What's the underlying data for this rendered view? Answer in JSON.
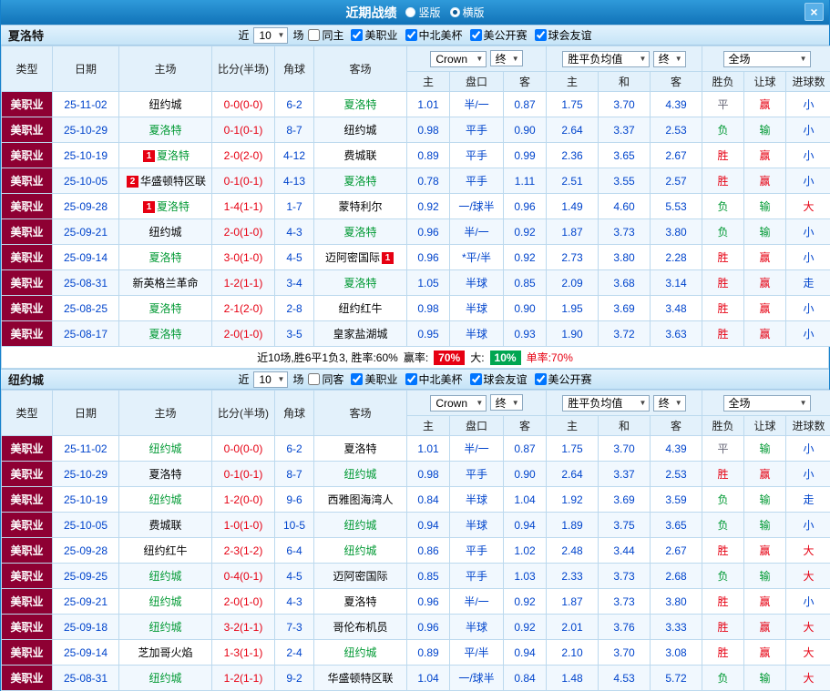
{
  "titlebar": {
    "title": "近期战绩",
    "layout_options": [
      {
        "label": "竖版",
        "checked": false
      },
      {
        "label": "横版",
        "checked": true
      }
    ],
    "close_icon": "×"
  },
  "filter_common": {
    "near": "近",
    "near_value": "10",
    "games": "场"
  },
  "columns": {
    "type": "类型",
    "date": "日期",
    "home": "主场",
    "score": "比分(半场)",
    "corner": "角球",
    "away": "客场",
    "company_select": "Crown",
    "final_select": "终",
    "odds_avg_select": "胜平负均值",
    "odds_final_select": "终",
    "scope_select": "全场",
    "sub_home": "主",
    "sub_handicap": "盘口",
    "sub_away": "客",
    "sub_win": "主",
    "sub_draw": "和",
    "sub_lose": "客",
    "res_wdl": "胜负",
    "res_handicap": "让球",
    "res_goals": "进球数"
  },
  "sections": [
    {
      "team": "夏洛特",
      "checkboxes": [
        {
          "label": "同主",
          "checked": false
        },
        {
          "label": "美职业",
          "checked": true
        },
        {
          "label": "中北美杯",
          "checked": true
        },
        {
          "label": "美公开赛",
          "checked": true
        },
        {
          "label": "球会友谊",
          "checked": true
        }
      ],
      "rows": [
        {
          "type": "美职业",
          "date": "25-11-02",
          "hbadge": "",
          "home": "纽约城",
          "hc": "",
          "score": "0-0(0-0)",
          "corner": "6-2",
          "away": "夏洛特",
          "abadge": "",
          "ac": "green",
          "o1": "1.01",
          "pan": "半/一",
          "o2": "0.87",
          "e1": "1.75",
          "e2": "3.70",
          "e3": "4.39",
          "r1": "平",
          "r1c": "gray",
          "r2": "赢",
          "r2c": "red",
          "r3": "小",
          "r3c": "blue"
        },
        {
          "type": "美职业",
          "date": "25-10-29",
          "hbadge": "",
          "home": "夏洛特",
          "hc": "green",
          "score": "0-1(0-1)",
          "corner": "8-7",
          "away": "纽约城",
          "abadge": "",
          "ac": "",
          "o1": "0.98",
          "pan": "平手",
          "o2": "0.90",
          "e1": "2.64",
          "e2": "3.37",
          "e3": "2.53",
          "r1": "负",
          "r1c": "green",
          "r2": "输",
          "r2c": "green",
          "r3": "小",
          "r3c": "blue"
        },
        {
          "type": "美职业",
          "date": "25-10-19",
          "hbadge": "1",
          "home": "夏洛特",
          "hc": "green",
          "score": "2-0(2-0)",
          "corner": "4-12",
          "away": "费城联",
          "abadge": "",
          "ac": "",
          "o1": "0.89",
          "pan": "平手",
          "o2": "0.99",
          "e1": "2.36",
          "e2": "3.65",
          "e3": "2.67",
          "r1": "胜",
          "r1c": "red",
          "r2": "赢",
          "r2c": "red",
          "r3": "小",
          "r3c": "blue"
        },
        {
          "type": "美职业",
          "date": "25-10-05",
          "hbadge": "2",
          "home": "华盛顿特区联",
          "hc": "",
          "score": "0-1(0-1)",
          "corner": "4-13",
          "away": "夏洛特",
          "abadge": "",
          "ac": "green",
          "o1": "0.78",
          "pan": "平手",
          "o2": "1.11",
          "e1": "2.51",
          "e2": "3.55",
          "e3": "2.57",
          "r1": "胜",
          "r1c": "red",
          "r2": "赢",
          "r2c": "red",
          "r3": "小",
          "r3c": "blue"
        },
        {
          "type": "美职业",
          "date": "25-09-28",
          "hbadge": "1",
          "home": "夏洛特",
          "hc": "green",
          "score": "1-4(1-1)",
          "corner": "1-7",
          "away": "蒙特利尔",
          "abadge": "",
          "ac": "",
          "o1": "0.92",
          "pan": "一/球半",
          "o2": "0.96",
          "e1": "1.49",
          "e2": "4.60",
          "e3": "5.53",
          "r1": "负",
          "r1c": "green",
          "r2": "输",
          "r2c": "green",
          "r3": "大",
          "r3c": "red"
        },
        {
          "type": "美职业",
          "date": "25-09-21",
          "hbadge": "",
          "home": "纽约城",
          "hc": "",
          "score": "2-0(1-0)",
          "corner": "4-3",
          "away": "夏洛特",
          "abadge": "",
          "ac": "green",
          "o1": "0.96",
          "pan": "半/一",
          "o2": "0.92",
          "e1": "1.87",
          "e2": "3.73",
          "e3": "3.80",
          "r1": "负",
          "r1c": "green",
          "r2": "输",
          "r2c": "green",
          "r3": "小",
          "r3c": "blue"
        },
        {
          "type": "美职业",
          "date": "25-09-14",
          "hbadge": "",
          "home": "夏洛特",
          "hc": "green",
          "score": "3-0(1-0)",
          "corner": "4-5",
          "away": "迈阿密国际",
          "abadge": "1",
          "ac": "",
          "o1": "0.96",
          "pan": "*平/半",
          "o2": "0.92",
          "e1": "2.73",
          "e2": "3.80",
          "e3": "2.28",
          "r1": "胜",
          "r1c": "red",
          "r2": "赢",
          "r2c": "red",
          "r3": "小",
          "r3c": "blue"
        },
        {
          "type": "美职业",
          "date": "25-08-31",
          "hbadge": "",
          "home": "新英格兰革命",
          "hc": "",
          "score": "1-2(1-1)",
          "corner": "3-4",
          "away": "夏洛特",
          "abadge": "",
          "ac": "green",
          "o1": "1.05",
          "pan": "半球",
          "o2": "0.85",
          "e1": "2.09",
          "e2": "3.68",
          "e3": "3.14",
          "r1": "胜",
          "r1c": "red",
          "r2": "赢",
          "r2c": "red",
          "r3": "走",
          "r3c": "blue"
        },
        {
          "type": "美职业",
          "date": "25-08-25",
          "hbadge": "",
          "home": "夏洛特",
          "hc": "green",
          "score": "2-1(2-0)",
          "corner": "2-8",
          "away": "纽约红牛",
          "abadge": "",
          "ac": "",
          "o1": "0.98",
          "pan": "半球",
          "o2": "0.90",
          "e1": "1.95",
          "e2": "3.69",
          "e3": "3.48",
          "r1": "胜",
          "r1c": "red",
          "r2": "赢",
          "r2c": "red",
          "r3": "小",
          "r3c": "blue"
        },
        {
          "type": "美职业",
          "date": "25-08-17",
          "hbadge": "",
          "home": "夏洛特",
          "hc": "green",
          "score": "2-0(1-0)",
          "corner": "3-5",
          "away": "皇家盐湖城",
          "abadge": "",
          "ac": "",
          "o1": "0.95",
          "pan": "半球",
          "o2": "0.93",
          "e1": "1.90",
          "e2": "3.72",
          "e3": "3.63",
          "r1": "胜",
          "r1c": "red",
          "r2": "赢",
          "r2c": "red",
          "r3": "小",
          "r3c": "blue"
        }
      ],
      "summary": {
        "stats": "近10场,胜6平1负3, 胜率:60%",
        "win_label": "赢率:",
        "win_value": "70%",
        "big_label": "大:",
        "big_value": "10%",
        "single": "单率:70%"
      }
    },
    {
      "team": "纽约城",
      "checkboxes": [
        {
          "label": "同客",
          "checked": false
        },
        {
          "label": "美职业",
          "checked": true
        },
        {
          "label": "中北美杯",
          "checked": true
        },
        {
          "label": "球会友谊",
          "checked": true
        },
        {
          "label": "美公开赛",
          "checked": true
        }
      ],
      "rows": [
        {
          "type": "美职业",
          "date": "25-11-02",
          "hbadge": "",
          "home": "纽约城",
          "hc": "green",
          "score": "0-0(0-0)",
          "corner": "6-2",
          "away": "夏洛特",
          "abadge": "",
          "ac": "",
          "o1": "1.01",
          "pan": "半/一",
          "o2": "0.87",
          "e1": "1.75",
          "e2": "3.70",
          "e3": "4.39",
          "r1": "平",
          "r1c": "gray",
          "r2": "输",
          "r2c": "green",
          "r3": "小",
          "r3c": "blue"
        },
        {
          "type": "美职业",
          "date": "25-10-29",
          "hbadge": "",
          "home": "夏洛特",
          "hc": "",
          "score": "0-1(0-1)",
          "corner": "8-7",
          "away": "纽约城",
          "abadge": "",
          "ac": "green",
          "o1": "0.98",
          "pan": "平手",
          "o2": "0.90",
          "e1": "2.64",
          "e2": "3.37",
          "e3": "2.53",
          "r1": "胜",
          "r1c": "red",
          "r2": "赢",
          "r2c": "red",
          "r3": "小",
          "r3c": "blue"
        },
        {
          "type": "美职业",
          "date": "25-10-19",
          "hbadge": "",
          "home": "纽约城",
          "hc": "green",
          "score": "1-2(0-0)",
          "corner": "9-6",
          "away": "西雅图海湾人",
          "abadge": "",
          "ac": "",
          "o1": "0.84",
          "pan": "半球",
          "o2": "1.04",
          "e1": "1.92",
          "e2": "3.69",
          "e3": "3.59",
          "r1": "负",
          "r1c": "green",
          "r2": "输",
          "r2c": "green",
          "r3": "走",
          "r3c": "blue"
        },
        {
          "type": "美职业",
          "date": "25-10-05",
          "hbadge": "",
          "home": "费城联",
          "hc": "",
          "score": "1-0(1-0)",
          "corner": "10-5",
          "away": "纽约城",
          "abadge": "",
          "ac": "green",
          "o1": "0.94",
          "pan": "半球",
          "o2": "0.94",
          "e1": "1.89",
          "e2": "3.75",
          "e3": "3.65",
          "r1": "负",
          "r1c": "green",
          "r2": "输",
          "r2c": "green",
          "r3": "小",
          "r3c": "blue"
        },
        {
          "type": "美职业",
          "date": "25-09-28",
          "hbadge": "",
          "home": "纽约红牛",
          "hc": "",
          "score": "2-3(1-2)",
          "corner": "6-4",
          "away": "纽约城",
          "abadge": "",
          "ac": "green",
          "o1": "0.86",
          "pan": "平手",
          "o2": "1.02",
          "e1": "2.48",
          "e2": "3.44",
          "e3": "2.67",
          "r1": "胜",
          "r1c": "red",
          "r2": "赢",
          "r2c": "red",
          "r3": "大",
          "r3c": "red"
        },
        {
          "type": "美职业",
          "date": "25-09-25",
          "hbadge": "",
          "home": "纽约城",
          "hc": "green",
          "score": "0-4(0-1)",
          "corner": "4-5",
          "away": "迈阿密国际",
          "abadge": "",
          "ac": "",
          "o1": "0.85",
          "pan": "平手",
          "o2": "1.03",
          "e1": "2.33",
          "e2": "3.73",
          "e3": "2.68",
          "r1": "负",
          "r1c": "green",
          "r2": "输",
          "r2c": "green",
          "r3": "大",
          "r3c": "red"
        },
        {
          "type": "美职业",
          "date": "25-09-21",
          "hbadge": "",
          "home": "纽约城",
          "hc": "green",
          "score": "2-0(1-0)",
          "corner": "4-3",
          "away": "夏洛特",
          "abadge": "",
          "ac": "",
          "o1": "0.96",
          "pan": "半/一",
          "o2": "0.92",
          "e1": "1.87",
          "e2": "3.73",
          "e3": "3.80",
          "r1": "胜",
          "r1c": "red",
          "r2": "赢",
          "r2c": "red",
          "r3": "小",
          "r3c": "blue"
        },
        {
          "type": "美职业",
          "date": "25-09-18",
          "hbadge": "",
          "home": "纽约城",
          "hc": "green",
          "score": "3-2(1-1)",
          "corner": "7-3",
          "away": "哥伦布机员",
          "abadge": "",
          "ac": "",
          "o1": "0.96",
          "pan": "半球",
          "o2": "0.92",
          "e1": "2.01",
          "e2": "3.76",
          "e3": "3.33",
          "r1": "胜",
          "r1c": "red",
          "r2": "赢",
          "r2c": "red",
          "r3": "大",
          "r3c": "red"
        },
        {
          "type": "美职业",
          "date": "25-09-14",
          "hbadge": "",
          "home": "芝加哥火焰",
          "hc": "",
          "score": "1-3(1-1)",
          "corner": "2-4",
          "away": "纽约城",
          "abadge": "",
          "ac": "green",
          "o1": "0.89",
          "pan": "平/半",
          "o2": "0.94",
          "e1": "2.10",
          "e2": "3.70",
          "e3": "3.08",
          "r1": "胜",
          "r1c": "red",
          "r2": "赢",
          "r2c": "red",
          "r3": "大",
          "r3c": "red"
        },
        {
          "type": "美职业",
          "date": "25-08-31",
          "hbadge": "",
          "home": "纽约城",
          "hc": "green",
          "score": "1-2(1-1)",
          "corner": "9-2",
          "away": "华盛顿特区联",
          "abadge": "",
          "ac": "",
          "o1": "1.04",
          "pan": "一/球半",
          "o2": "0.84",
          "e1": "1.48",
          "e2": "4.53",
          "e3": "5.72",
          "r1": "负",
          "r1c": "green",
          "r2": "输",
          "r2c": "green",
          "r3": "大",
          "r3c": "red"
        }
      ]
    }
  ]
}
